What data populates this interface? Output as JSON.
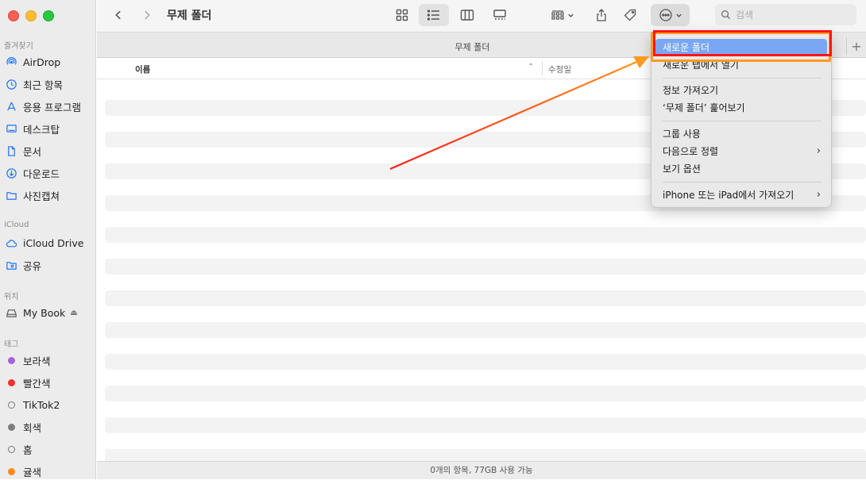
{
  "window": {
    "title": "무제 폴더",
    "tab_title": "무제 폴더"
  },
  "sidebar": {
    "sections": {
      "favorites": "즐겨찾기",
      "icloud": "iCloud",
      "locations": "위치",
      "tags": "태그"
    },
    "favorites": [
      {
        "label": "AirDrop",
        "icon": "airdrop-icon"
      },
      {
        "label": "최근 항목",
        "icon": "clock-icon"
      },
      {
        "label": "응용 프로그램",
        "icon": "applications-icon"
      },
      {
        "label": "데스크탑",
        "icon": "desktop-icon"
      },
      {
        "label": "문서",
        "icon": "document-icon"
      },
      {
        "label": "다운로드",
        "icon": "download-icon"
      },
      {
        "label": "사진캡쳐",
        "icon": "folder-icon"
      }
    ],
    "icloud": [
      {
        "label": "iCloud Drive",
        "icon": "cloud-icon"
      },
      {
        "label": "공유",
        "icon": "shared-folder-icon"
      }
    ],
    "locations": [
      {
        "label": "My Book",
        "icon": "drive-icon",
        "eject": "⏏"
      }
    ],
    "tags": [
      {
        "label": "보라색",
        "color": "#a463d8"
      },
      {
        "label": "빨간색",
        "color": "#f2302d"
      },
      {
        "label": "TikTok2",
        "color": "hollow"
      },
      {
        "label": "회색",
        "color": "#7d7d7d"
      },
      {
        "label": "홈",
        "color": "hollow"
      },
      {
        "label": "귤색",
        "color": "#fb8a1c"
      }
    ]
  },
  "toolbar": {
    "search_placeholder": "검색",
    "view_modes": [
      "icon-view-icon",
      "list-view-icon",
      "column-view-icon",
      "gallery-view-icon"
    ],
    "active_view": "list-view-icon"
  },
  "columns": {
    "name": "이름",
    "sort_indicator": "⌃",
    "date_modified": "수정일"
  },
  "status": {
    "text": "0개의 항목, 77GB 사용 가능"
  },
  "context_menu": {
    "items": [
      {
        "label": "새로운 폴더",
        "highlighted": true
      },
      {
        "label": "새로운 탭에서 열기"
      },
      {
        "label": "정보 가져오기"
      },
      {
        "label": "‘무제 폴더’ 훑어보기"
      },
      {
        "label": "그룹 사용"
      },
      {
        "label": "다음으로 정렬",
        "submenu": true
      },
      {
        "label": "보기 옵션"
      },
      {
        "label": "iPhone 또는 iPad에서 가져오기",
        "submenu": true
      }
    ],
    "submenu_chevron": "›"
  },
  "annotation": {
    "arrow_colors": [
      "#ff1a1a",
      "#ff9a1f"
    ],
    "box_colors": [
      "#ff1414",
      "#ff9a1f"
    ]
  }
}
